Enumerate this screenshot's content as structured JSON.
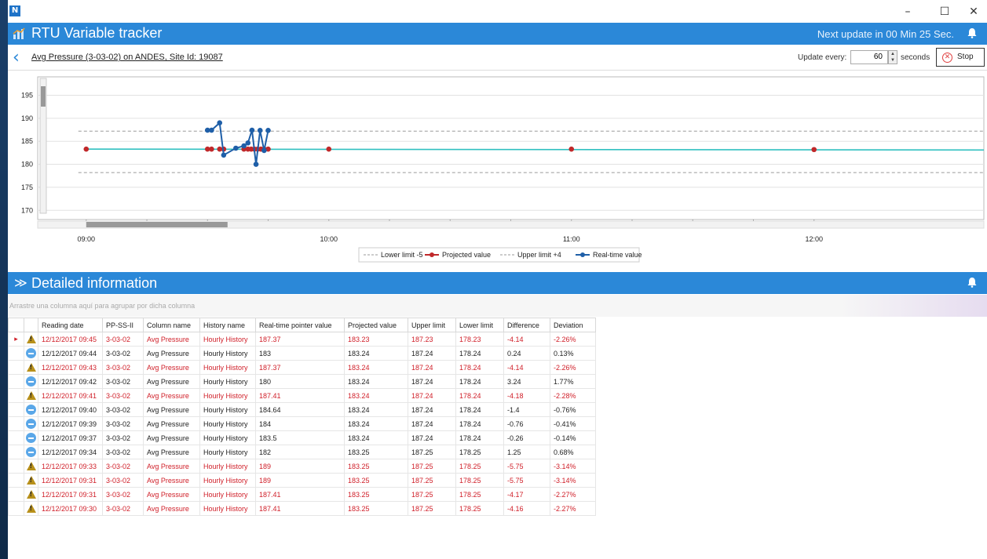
{
  "window": {
    "app_icon_letter": "N",
    "minimize": "–",
    "maximize": "☐",
    "close": "✕"
  },
  "header": {
    "title": "RTU Variable tracker",
    "next_update": "Next update in 00 Min 25 Sec."
  },
  "subbar": {
    "variable_link": "Avg Pressure (3-03-02) on ANDES, Site Id: 19087",
    "update_every_label": "Update every:",
    "update_every_value": "60",
    "seconds_label": "seconds",
    "stop_label": "Stop"
  },
  "chart_data": {
    "type": "line",
    "ylim": [
      168,
      199
    ],
    "y_ticks": [
      170,
      175,
      180,
      185,
      190,
      195
    ],
    "x_ticks": [
      "09:00",
      "10:00",
      "11:00",
      "12:00"
    ],
    "x_range_minutes": [
      -12,
      222
    ],
    "limits": {
      "lower": 178.2,
      "upper": 187.2
    },
    "series": [
      {
        "name": "Projected value",
        "color": "#c0282a",
        "points": [
          {
            "x": 0,
            "y": 183.3
          },
          {
            "x": 30,
            "y": 183.3
          },
          {
            "x": 31,
            "y": 183.3
          },
          {
            "x": 33,
            "y": 183.3
          },
          {
            "x": 34,
            "y": 183.3
          },
          {
            "x": 39,
            "y": 183.3
          },
          {
            "x": 40,
            "y": 183.3
          },
          {
            "x": 40.8,
            "y": 183.3
          },
          {
            "x": 41.6,
            "y": 183.3
          },
          {
            "x": 42.4,
            "y": 183.3
          },
          {
            "x": 43.2,
            "y": 183.3
          },
          {
            "x": 44,
            "y": 183.3
          },
          {
            "x": 45,
            "y": 183.3
          },
          {
            "x": 60,
            "y": 183.3
          },
          {
            "x": 120,
            "y": 183.3
          },
          {
            "x": 180,
            "y": 183.2
          }
        ]
      },
      {
        "name": "Real-time value",
        "color": "#1f5fa8",
        "points": [
          {
            "x": 30,
            "y": 187.41
          },
          {
            "x": 31,
            "y": 187.41
          },
          {
            "x": 33,
            "y": 189
          },
          {
            "x": 34,
            "y": 182
          },
          {
            "x": 37,
            "y": 183.5
          },
          {
            "x": 39,
            "y": 184
          },
          {
            "x": 40,
            "y": 184.64
          },
          {
            "x": 41,
            "y": 187.41
          },
          {
            "x": 42,
            "y": 180
          },
          {
            "x": 43,
            "y": 187.37
          },
          {
            "x": 44,
            "y": 183
          },
          {
            "x": 45,
            "y": 187.37
          }
        ]
      }
    ],
    "legend": [
      "Lower limit -5",
      "Projected value",
      "Upper limit +4",
      "Real-time value"
    ],
    "legend_position": "bottom-center"
  },
  "detail": {
    "title": "Detailed information",
    "group_hint": "Arrastre una columna aquí para agrupar por dicha columna",
    "columns": [
      "Reading date",
      "PP-SS-II",
      "Column name",
      "History name",
      "Real-time pointer value",
      "Projected value",
      "Upper limit",
      "Lower limit",
      "Difference",
      "Deviation"
    ],
    "rows": [
      {
        "status": "warn",
        "cells": [
          "12/12/2017 09:45",
          "3-03-02",
          "Avg Pressure",
          "Hourly History",
          "187.37",
          "183.23",
          "187.23",
          "178.23",
          "-4.14",
          "-2.26%"
        ]
      },
      {
        "status": "ok",
        "cells": [
          "12/12/2017 09:44",
          "3-03-02",
          "Avg Pressure",
          "Hourly History",
          "183",
          "183.24",
          "187.24",
          "178.24",
          "0.24",
          "0.13%"
        ]
      },
      {
        "status": "warn",
        "cells": [
          "12/12/2017 09:43",
          "3-03-02",
          "Avg Pressure",
          "Hourly History",
          "187.37",
          "183.24",
          "187.24",
          "178.24",
          "-4.14",
          "-2.26%"
        ]
      },
      {
        "status": "ok",
        "cells": [
          "12/12/2017 09:42",
          "3-03-02",
          "Avg Pressure",
          "Hourly History",
          "180",
          "183.24",
          "187.24",
          "178.24",
          "3.24",
          "1.77%"
        ]
      },
      {
        "status": "warn",
        "cells": [
          "12/12/2017 09:41",
          "3-03-02",
          "Avg Pressure",
          "Hourly History",
          "187.41",
          "183.24",
          "187.24",
          "178.24",
          "-4.18",
          "-2.28%"
        ]
      },
      {
        "status": "ok",
        "cells": [
          "12/12/2017 09:40",
          "3-03-02",
          "Avg Pressure",
          "Hourly History",
          "184.64",
          "183.24",
          "187.24",
          "178.24",
          "-1.4",
          "-0.76%"
        ]
      },
      {
        "status": "ok",
        "cells": [
          "12/12/2017 09:39",
          "3-03-02",
          "Avg Pressure",
          "Hourly History",
          "184",
          "183.24",
          "187.24",
          "178.24",
          "-0.76",
          "-0.41%"
        ]
      },
      {
        "status": "ok",
        "cells": [
          "12/12/2017 09:37",
          "3-03-02",
          "Avg Pressure",
          "Hourly History",
          "183.5",
          "183.24",
          "187.24",
          "178.24",
          "-0.26",
          "-0.14%"
        ]
      },
      {
        "status": "ok",
        "cells": [
          "12/12/2017 09:34",
          "3-03-02",
          "Avg Pressure",
          "Hourly History",
          "182",
          "183.25",
          "187.25",
          "178.25",
          "1.25",
          "0.68%"
        ]
      },
      {
        "status": "warn",
        "cells": [
          "12/12/2017 09:33",
          "3-03-02",
          "Avg Pressure",
          "Hourly History",
          "189",
          "183.25",
          "187.25",
          "178.25",
          "-5.75",
          "-3.14%"
        ]
      },
      {
        "status": "warn",
        "cells": [
          "12/12/2017 09:31",
          "3-03-02",
          "Avg Pressure",
          "Hourly History",
          "189",
          "183.25",
          "187.25",
          "178.25",
          "-5.75",
          "-3.14%"
        ]
      },
      {
        "status": "warn",
        "cells": [
          "12/12/2017 09:31",
          "3-03-02",
          "Avg Pressure",
          "Hourly History",
          "187.41",
          "183.25",
          "187.25",
          "178.25",
          "-4.17",
          "-2.27%"
        ]
      },
      {
        "status": "warn",
        "cells": [
          "12/12/2017 09:30",
          "3-03-02",
          "Avg Pressure",
          "Hourly History",
          "187.41",
          "183.25",
          "187.25",
          "178.25",
          "-4.16",
          "-2.27%"
        ]
      }
    ]
  },
  "colors": {
    "accent": "#2b88d8",
    "warn": "#d0202a",
    "projected": "#c0282a",
    "realtime": "#1f5fa8",
    "trend": "#30c0c0",
    "limit": "#9a9a9a"
  },
  "icons": {
    "header": "chart-icon",
    "bell": "bell-icon",
    "back": "back-arrow-icon",
    "stop": "stop-circle-icon",
    "warn": "warning-icon",
    "ok": "info-minus-icon"
  }
}
